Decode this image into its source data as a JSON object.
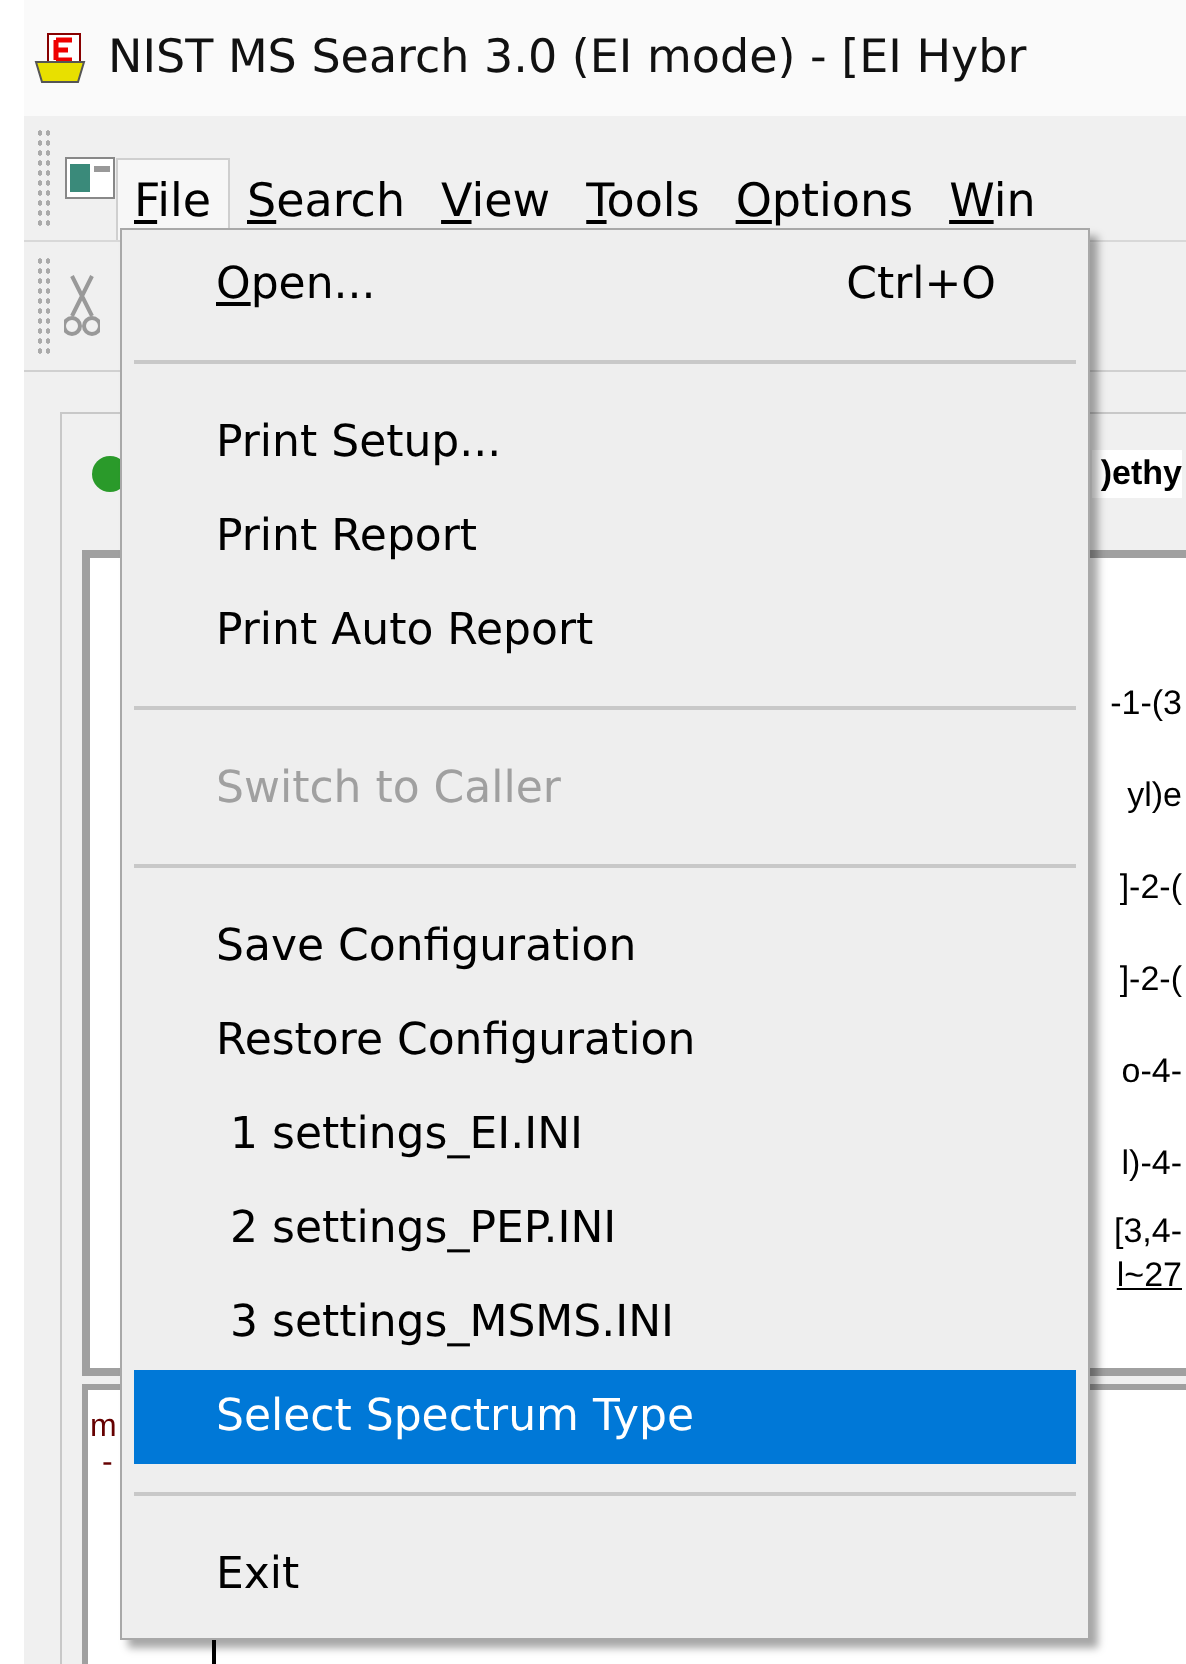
{
  "window": {
    "title": "NIST MS Search 3.0 (EI mode) - [EI Hybr"
  },
  "menu_bar": [
    {
      "label": "File",
      "selected": true,
      "mnemonic_first": true
    },
    {
      "label": "Search",
      "selected": false,
      "mnemonic_first": true
    },
    {
      "label": "View",
      "selected": false,
      "mnemonic_first": true
    },
    {
      "label": "Tools",
      "selected": false,
      "mnemonic_first": true
    },
    {
      "label": "Options",
      "selected": false,
      "mnemonic_first": true
    },
    {
      "label": "Win",
      "selected": false,
      "mnemonic_first": true
    }
  ],
  "tab": {
    "label": ")ethy"
  },
  "hit_list": [
    "-1-(3",
    "yl)e",
    "]-2-(",
    "]-2-(",
    "o-4-",
    "l)-4-",
    "[3,4-",
    "l~27"
  ],
  "lower_pane": {
    "text": "m",
    "text_2": "-"
  },
  "file_menu": [
    {
      "kind": "item",
      "label": "Open...",
      "shortcut": "Ctrl+O",
      "disabled": false,
      "selected": false,
      "mnemonic_first": true
    },
    {
      "kind": "separator"
    },
    {
      "kind": "item",
      "label": "Print Setup...",
      "disabled": false,
      "selected": false
    },
    {
      "kind": "item",
      "label": "Print Report",
      "disabled": false,
      "selected": false
    },
    {
      "kind": "item",
      "label": "Print Auto Report",
      "disabled": false,
      "selected": false
    },
    {
      "kind": "separator"
    },
    {
      "kind": "item",
      "label": "Switch to Caller",
      "disabled": true,
      "selected": false
    },
    {
      "kind": "separator"
    },
    {
      "kind": "item",
      "label": "Save Configuration",
      "disabled": false,
      "selected": false
    },
    {
      "kind": "item",
      "label": "Restore Configuration",
      "disabled": false,
      "selected": false
    },
    {
      "kind": "item",
      "label": " 1 settings_EI.INI",
      "disabled": false,
      "selected": false
    },
    {
      "kind": "item",
      "label": " 2 settings_PEP.INI",
      "disabled": false,
      "selected": false
    },
    {
      "kind": "item",
      "label": " 3 settings_MSMS.INI",
      "disabled": false,
      "selected": false
    },
    {
      "kind": "item",
      "label": "Select Spectrum Type",
      "disabled": false,
      "selected": true
    },
    {
      "kind": "separator"
    },
    {
      "kind": "item",
      "label": "Exit",
      "disabled": false,
      "selected": false
    }
  ]
}
